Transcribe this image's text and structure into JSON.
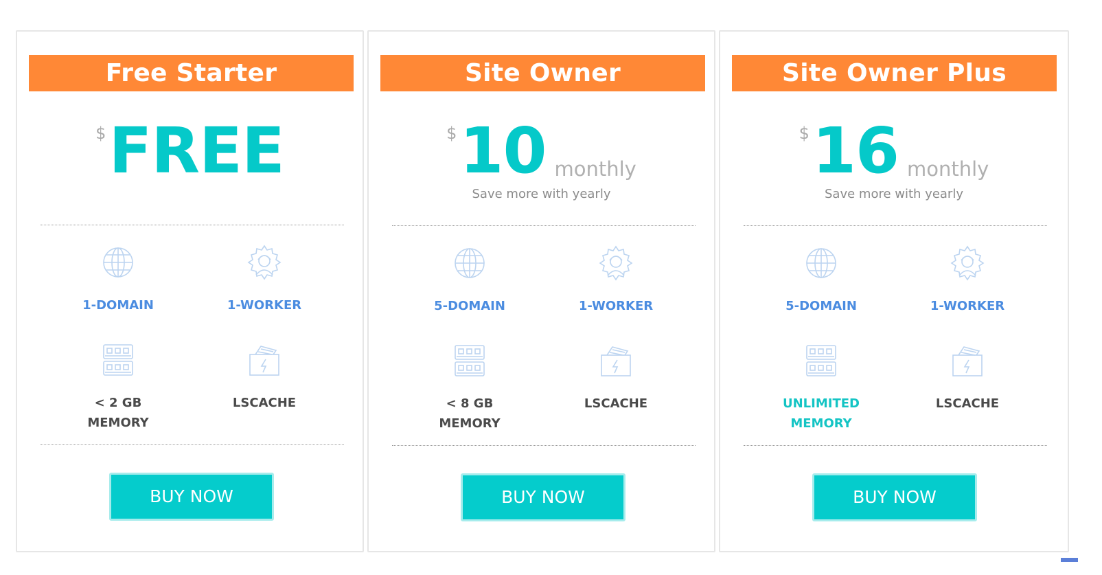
{
  "plans": [
    {
      "title": "Free Starter",
      "currency": "$",
      "amount": "FREE",
      "period": "",
      "note": "",
      "features": {
        "domain": "1-DOMAIN",
        "worker": "1-WORKER",
        "memory": [
          "< 2 GB",
          "MEMORY"
        ],
        "cache": "LSCACHE"
      },
      "button": "BUY NOW"
    },
    {
      "title": "Site Owner",
      "currency": "$",
      "amount": "10",
      "period": "monthly",
      "note": "Save more with yearly",
      "features": {
        "domain": "5-DOMAIN",
        "worker": "1-WORKER",
        "memory": [
          "< 8 GB",
          "MEMORY"
        ],
        "cache": "LSCACHE"
      },
      "button": "BUY NOW"
    },
    {
      "title": "Site Owner Plus",
      "currency": "$",
      "amount": "16",
      "period": "monthly",
      "note": "Save more with yearly",
      "features": {
        "domain": "5-DOMAIN",
        "worker": "1-WORKER",
        "memory": [
          "UNLIMITED",
          "MEMORY"
        ],
        "cache": "LSCACHE"
      },
      "button": "BUY NOW"
    }
  ],
  "icons": {
    "domain": "globe-icon",
    "worker": "worker-gear-icon",
    "memory": "memory-module-icon",
    "cache": "lscache-icon"
  },
  "colors": {
    "header": "#ff8836",
    "price": "#05c9c9",
    "button": "#05cccc",
    "feature_blue": "#4b8ce0",
    "feature_teal": "#14c4c4"
  }
}
